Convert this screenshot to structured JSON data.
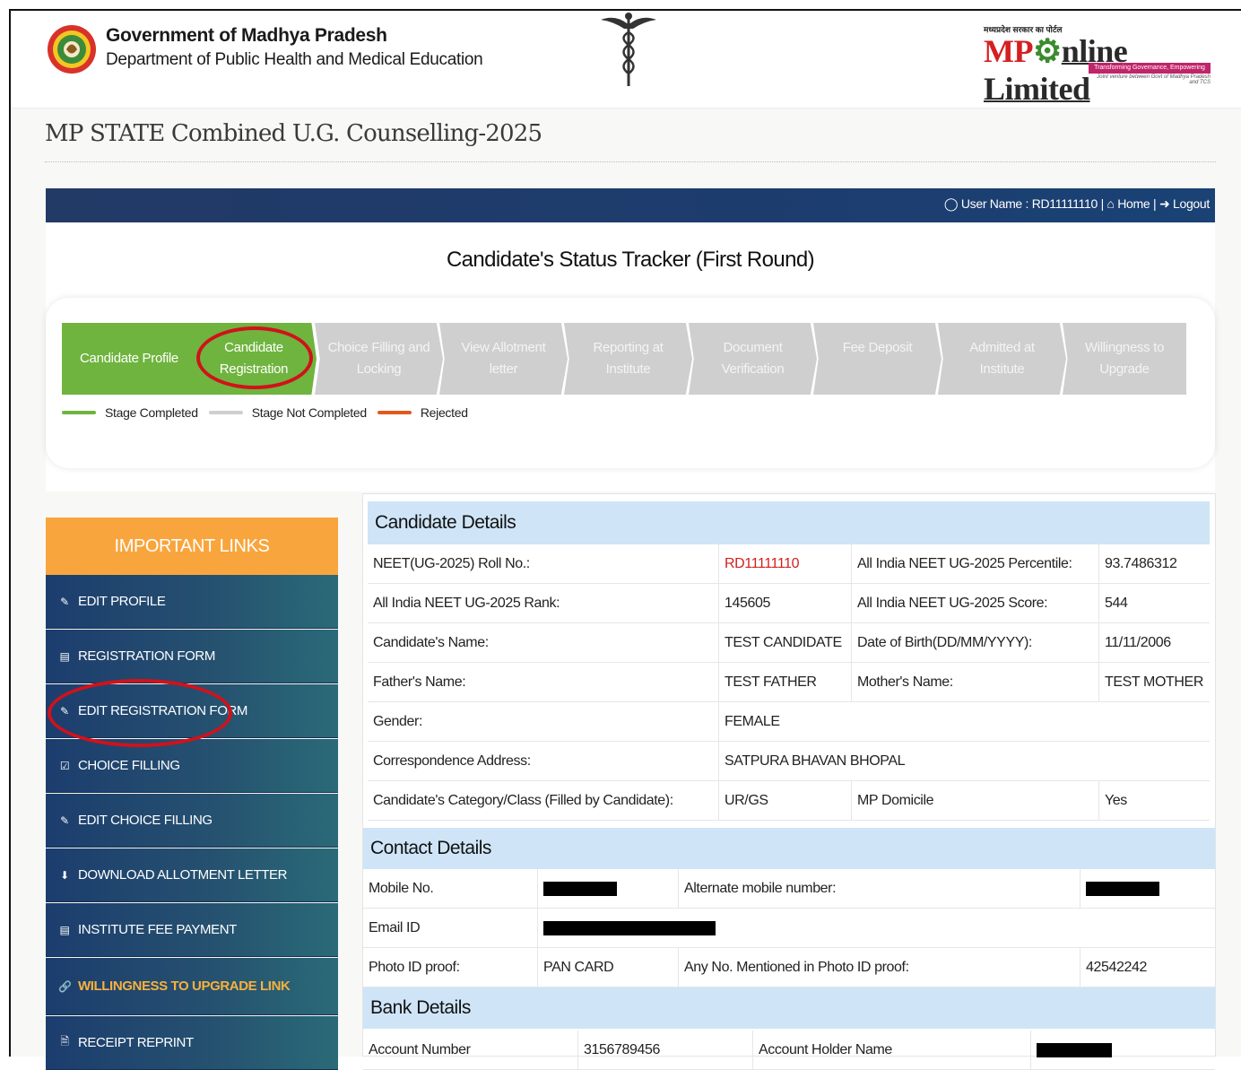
{
  "header": {
    "gov_title": "Government of Madhya Pradesh",
    "gov_subtitle": "Department of Public Health and Medical Education",
    "mp_tagline": "मध्यप्रदेश सरकार का पोर्टल",
    "mp_brand_prefix": "MP",
    "mp_brand_suffix": "nline Limited",
    "mp_band": "Transforming Governance, Empowering Citizens",
    "mp_band_sub": "Joint venture between Govt of Madhya Pradesh and TCS"
  },
  "page_title": "MP STATE Combined U.G. Counselling-2025",
  "topbar": {
    "user_label": "User Name : RD11111110",
    "home_label": "Home",
    "logout_label": "Logout",
    "sep1": "|",
    "sep2": "|"
  },
  "tracker": {
    "title": "Candidate's Status Tracker (First Round)",
    "steps": [
      {
        "line1": "Candidate Profile",
        "line2": "",
        "status": "done"
      },
      {
        "line1": "Candidate",
        "line2": "Registration",
        "status": "done"
      },
      {
        "line1": "Choice Filling and",
        "line2": "Locking",
        "status": "pending"
      },
      {
        "line1": "View Allotment",
        "line2": "letter",
        "status": "pending"
      },
      {
        "line1": "Reporting at",
        "line2": "Institute",
        "status": "pending"
      },
      {
        "line1": "Document",
        "line2": "Verification",
        "status": "pending"
      },
      {
        "line1": "Fee Deposit",
        "line2": "",
        "status": "pending"
      },
      {
        "line1": "Admitted at",
        "line2": "Institute",
        "status": "pending"
      },
      {
        "line1": "Willingness to",
        "line2": "Upgrade",
        "status": "pending"
      }
    ],
    "legend": {
      "completed": "Stage Completed",
      "not_completed": "Stage Not Completed",
      "rejected": "Rejected"
    },
    "colors": {
      "done": "#6fb43e",
      "pending": "#cfcfcf",
      "rejected": "#e05a1f"
    }
  },
  "sidebar": {
    "heading": "IMPORTANT LINKS",
    "items": [
      {
        "label": "EDIT PROFILE",
        "icon": "edit-icon"
      },
      {
        "label": "REGISTRATION FORM",
        "icon": "id-card-icon"
      },
      {
        "label": "EDIT REGISTRATION FORM",
        "icon": "edit-icon"
      },
      {
        "label": "CHOICE FILLING",
        "icon": "checkbox-icon"
      },
      {
        "label": "EDIT CHOICE FILLING",
        "icon": "edit-icon"
      },
      {
        "label": "DOWNLOAD ALLOTMENT LETTER",
        "icon": "download-icon"
      },
      {
        "label": "INSTITUTE FEE PAYMENT",
        "icon": "card-icon"
      },
      {
        "label": "WILLINGNESS TO UPGRADE LINK",
        "icon": "link-icon"
      },
      {
        "label": "RECEIPT REPRINT",
        "icon": "file-icon"
      }
    ]
  },
  "candidate_details": {
    "heading": "Candidate Details",
    "rows": [
      {
        "l1": "NEET(UG-2025) Roll No.:",
        "v1": "RD11111110",
        "l2": "All India NEET UG-2025 Percentile:",
        "v2": "93.7486312"
      },
      {
        "l1": "All India NEET UG-2025 Rank:",
        "v1": "145605",
        "l2": "All India NEET UG-2025 Score:",
        "v2": "544"
      },
      {
        "l1": "Candidate's Name:",
        "v1": "TEST CANDIDATE",
        "l2": "Date of Birth(DD/MM/YYYY):",
        "v2": "11/11/2006"
      },
      {
        "l1": "Father's Name:",
        "v1": "TEST FATHER",
        "l2": "Mother's Name:",
        "v2": "TEST MOTHER"
      },
      {
        "l1": "Gender:",
        "v1": "FEMALE",
        "l2": "",
        "v2": ""
      },
      {
        "l1": "Correspondence Address:",
        "v1": "SATPURA BHAVAN BHOPAL",
        "l2": "",
        "v2": ""
      },
      {
        "l1": "Candidate's Category/Class (Filled by Candidate):",
        "v1": "UR/GS",
        "l2": "MP Domicile",
        "v2": "Yes"
      }
    ]
  },
  "contact_details": {
    "heading": "Contact Details",
    "mobile_label": "Mobile No.",
    "alt_mobile_label": "Alternate mobile number:",
    "email_label": "Email ID",
    "photo_id_label": "Photo ID proof:",
    "photo_id_value": "PAN CARD",
    "id_no_label": "Any No. Mentioned in Photo ID proof:",
    "id_no_value": "42542242"
  },
  "bank_details": {
    "heading": "Bank Details",
    "account_label": "Account Number",
    "account_value": "3156789456",
    "holder_label": "Account Holder Name"
  }
}
